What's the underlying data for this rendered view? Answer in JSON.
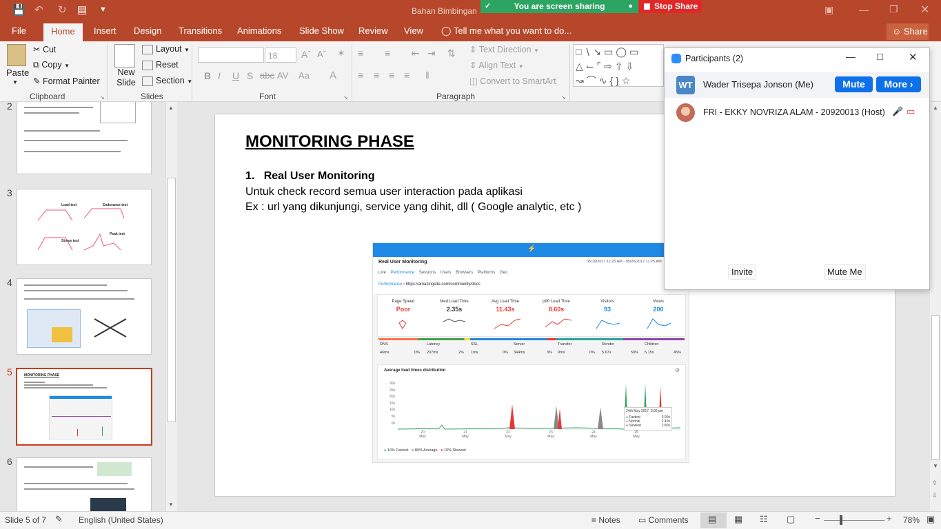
{
  "titlebar": {
    "doc_title": "Bahan Bimbingan",
    "buttons": [
      "minimize",
      "restore",
      "close"
    ]
  },
  "zoom_share": {
    "sharing_text": "You are screen sharing",
    "stop_label": "Stop Share"
  },
  "tabs": [
    "File",
    "Home",
    "Insert",
    "Design",
    "Transitions",
    "Animations",
    "Slide Show",
    "Review",
    "View"
  ],
  "tell_me": "Tell me what you want to do...",
  "share_label": "Share",
  "ribbon": {
    "paste": "Paste",
    "cut": "Cut",
    "copy": "Copy",
    "format_painter": "Format Painter",
    "new_slide": "New Slide",
    "layout": "Layout",
    "reset": "Reset",
    "section": "Section",
    "font_size": "18",
    "text_direction": "Text Direction",
    "align_text": "Align Text",
    "convert_smartart": "Convert to SmartArt",
    "groups": {
      "clipboard": "Clipboard",
      "slides": "Slides",
      "font": "Font",
      "paragraph": "Paragraph"
    }
  },
  "thumbnails": {
    "numbers": [
      "2",
      "3",
      "4",
      "5",
      "6"
    ],
    "slide3_labels": [
      "Load test",
      "Endurance test",
      "Stress test",
      "Peak test"
    ],
    "slide5_title": "MONITORING PHASE"
  },
  "slide": {
    "title": "MONITORING PHASE",
    "item_number": "1.",
    "item_title": "Real User Monitoring",
    "line1": "Untuk check record semua user interaction pada aplikasi",
    "line2": "Ex : url yang dikunjungi, service yang dihit, dll ( Google analytic, etc )"
  },
  "embedded": {
    "title": "Real User Monitoring",
    "date_range": "05/19/2017 11:25 AM - 05/26/2017 11:25 AM",
    "nav": [
      "Live",
      "Performance",
      "Sessions",
      "Users",
      "Browsers",
      "Platforms",
      "Geo"
    ],
    "breadcrumb": "Performance",
    "url": "https://amazingsite.com/community/docs",
    "metrics": [
      {
        "label": "Page Speed",
        "value": "Poor",
        "color": "#e53935"
      },
      {
        "label": "Med Load Time",
        "value": "2.35s",
        "color": "#333333"
      },
      {
        "label": "Avg Load Time",
        "value": "11.43s",
        "color": "#e53935"
      },
      {
        "label": "p90 Load Time",
        "value": "8.60s",
        "color": "#e53935"
      },
      {
        "label": "Visitors",
        "value": "93",
        "color": "#1e88e5"
      },
      {
        "label": "Views",
        "value": "200",
        "color": "#1e88e5"
      }
    ],
    "timings": [
      {
        "label": "DNS",
        "ms": "46ms",
        "pct": "0%"
      },
      {
        "label": "Latency",
        "ms": "207ms",
        "pct": "2%"
      },
      {
        "label": "SSL",
        "ms": "1ms",
        "pct": "0%"
      },
      {
        "label": "Server",
        "ms": "344ms",
        "pct": "3%"
      },
      {
        "label": "Transfer",
        "ms": "9ms",
        "pct": "0%"
      },
      {
        "label": "Render",
        "ms": "5.67s",
        "pct": "50%"
      },
      {
        "label": "Children",
        "ms": "5.15s",
        "pct": "45%"
      }
    ],
    "chart_title": "Average load times distribution",
    "y_ticks": [
      "30s",
      "25s",
      "20s",
      "15s",
      "10s",
      "5s",
      "0s"
    ],
    "x_ticks": [
      "20 May",
      "21 May",
      "22 May",
      "23 May",
      "24 May",
      "25 May"
    ],
    "tooltip": {
      "title": "24th May 2017, 3:00 pm",
      "rows": [
        [
          "Fastest",
          "3.90s"
        ],
        [
          "Normal",
          "2.40s"
        ],
        [
          "Slowest",
          "2.80s"
        ]
      ]
    },
    "legend": [
      "10% Fastest",
      "80% Average",
      "10% Slowest"
    ]
  },
  "participants": {
    "title": "Participants (2)",
    "me": {
      "initials": "WT",
      "name": "Wader Trisepa Jonson (Me)",
      "mute": "Mute",
      "more": "More"
    },
    "host": {
      "name": "FRI - EKKY NOVRIZA ALAM - 20920013 (Host)"
    },
    "invite": "Invite",
    "mute_me": "Mute Me"
  },
  "status": {
    "slide_of": "Slide 5 of 7",
    "language": "English (United States)",
    "notes": "Notes",
    "comments": "Comments",
    "zoom": "78%"
  },
  "colors": {
    "brand": "#b7472a",
    "zoom_blue": "#0e71eb",
    "share_green": "#2da562",
    "stop_red": "#e02828"
  }
}
